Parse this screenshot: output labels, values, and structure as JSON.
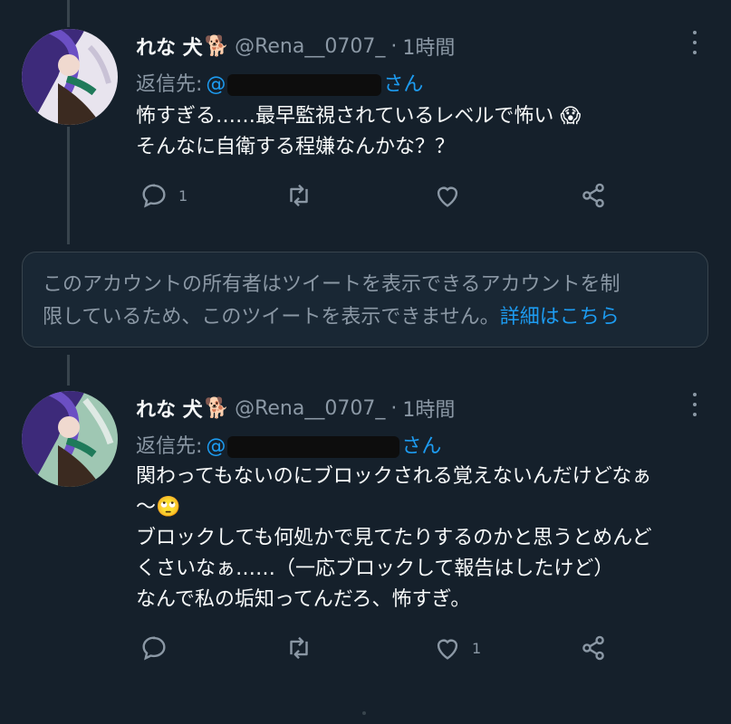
{
  "tweets": [
    {
      "name": "れな 犬",
      "emoji": "🐕",
      "handle": "@Rena__0707_",
      "separator": "·",
      "time": "1時間",
      "reply_label": "返信先:",
      "reply_prefix": "@",
      "reply_suffix": "さん",
      "body_lines": [
        "怖すぎる……最早監視されているレベルで怖い 😱",
        "そんなに自衛する程嫌なんかな？？"
      ],
      "actions": {
        "reply_count": "1",
        "retweet_count": "",
        "like_count": ""
      }
    },
    {
      "name": "れな 犬",
      "emoji": "🐕",
      "handle": "@Rena__0707_",
      "separator": "·",
      "time": "1時間",
      "reply_label": "返信先:",
      "reply_prefix": "@",
      "reply_suffix": "さん",
      "body_lines": [
        "関わってもないのにブロックされる覚えないんだけどなぁ",
        "〜🙄",
        "ブロックしても何処かで見てたりするのかと思うとめんど",
        "くさいなぁ……（一応ブロックして報告はしたけど）",
        "なんで私の垢知ってんだろ、怖すぎ。"
      ],
      "actions": {
        "reply_count": "",
        "retweet_count": "",
        "like_count": "1"
      }
    }
  ],
  "notice": {
    "line1": "このアカウントの所有者はツイートを表示できるアカウントを制",
    "line2": "限しているため、このツイートを表示できません。",
    "link": "詳細はこちら"
  },
  "icons": [
    "more-icon",
    "reply-icon",
    "retweet-icon",
    "like-icon",
    "share-icon"
  ],
  "colors": {
    "background": "#15202b",
    "text": "#f7f9f9",
    "muted": "#8b98a5",
    "link": "#1d9bf0",
    "border": "#38444d"
  }
}
